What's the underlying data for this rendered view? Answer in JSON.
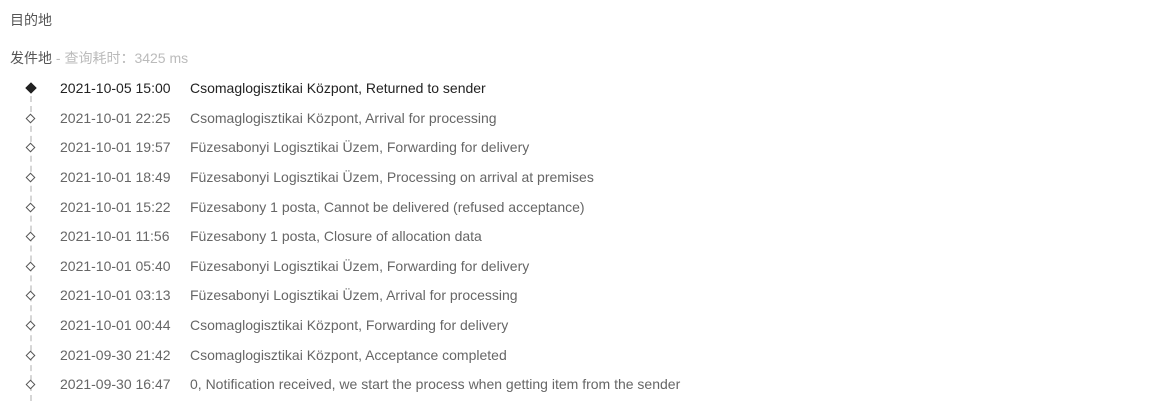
{
  "destination": {
    "label": "目的地"
  },
  "origin": {
    "label": "发件地",
    "separator": " - ",
    "query_time_label": "查询耗时：",
    "query_time_value": "3425 ms"
  },
  "events": [
    {
      "time": "2021-10-05 15:00",
      "description": "Csomaglogisztikai Központ, Returned to sender"
    },
    {
      "time": "2021-10-01 22:25",
      "description": "Csomaglogisztikai Központ, Arrival for processing"
    },
    {
      "time": "2021-10-01 19:57",
      "description": "Füzesabonyi Logisztikai Üzem, Forwarding for delivery"
    },
    {
      "time": "2021-10-01 18:49",
      "description": "Füzesabonyi Logisztikai Üzem, Processing on arrival at premises"
    },
    {
      "time": "2021-10-01 15:22",
      "description": "Füzesabony 1 posta, Cannot be delivered (refused acceptance)"
    },
    {
      "time": "2021-10-01 11:56",
      "description": "Füzesabony 1 posta, Closure of allocation data"
    },
    {
      "time": "2021-10-01 05:40",
      "description": "Füzesabonyi Logisztikai Üzem, Forwarding for delivery"
    },
    {
      "time": "2021-10-01 03:13",
      "description": "Füzesabonyi Logisztikai Üzem, Arrival for processing"
    },
    {
      "time": "2021-10-01 00:44",
      "description": "Csomaglogisztikai Központ, Forwarding for delivery"
    },
    {
      "time": "2021-09-30 21:42",
      "description": "Csomaglogisztikai Központ, Acceptance completed"
    },
    {
      "time": "2021-09-30 16:47",
      "description": "0, Notification received, we start the process when getting item from the sender"
    }
  ]
}
